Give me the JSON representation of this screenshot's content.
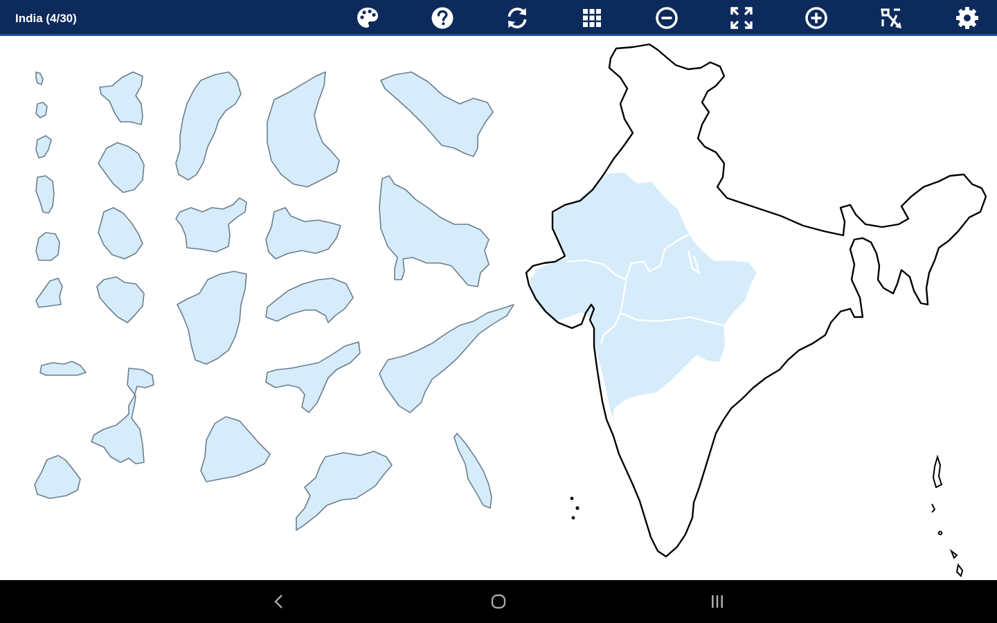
{
  "header": {
    "title": "India (4/30)"
  },
  "toolbar": {
    "icons": [
      "palette-icon",
      "help-icon",
      "refresh-icon",
      "grid-icon",
      "zoom-out-icon",
      "fit-screen-icon",
      "zoom-in-icon",
      "scatter-pieces-icon",
      "settings-icon"
    ]
  },
  "puzzle": {
    "placed_count": 4,
    "total_count": 30,
    "piece_color": "#d6ecfb",
    "outline_color": "#000000"
  },
  "colors": {
    "header_bg": "#0d2a5c",
    "nav_bg": "#000000"
  },
  "navigation": {
    "icons": [
      "back-icon",
      "home-icon",
      "recents-icon"
    ]
  }
}
